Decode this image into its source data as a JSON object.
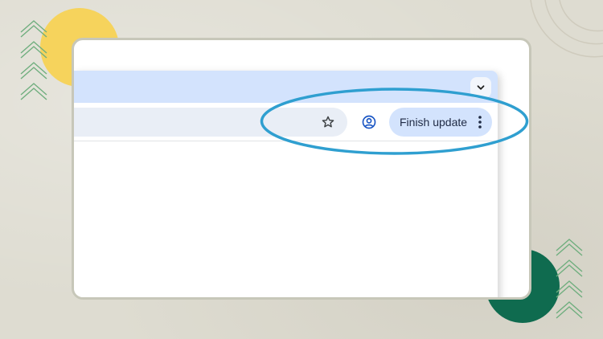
{
  "toolbar": {
    "finish_update_label": "Finish update"
  },
  "icons": {
    "tab_search": "chevron-down-icon",
    "bookmark": "star-icon",
    "profile": "account-circle-icon",
    "menu": "more-vert-icon"
  },
  "colors": {
    "background": "#dedcd1",
    "tabstrip": "#d3e3fd",
    "omnibox": "#e9eef6",
    "update_button": "#d3e3fd",
    "highlight_ring": "#2f9fd0",
    "profile_icon": "#1a56c4",
    "yellow_accent": "#f6d35c",
    "green_accent": "#0f6b4f"
  }
}
